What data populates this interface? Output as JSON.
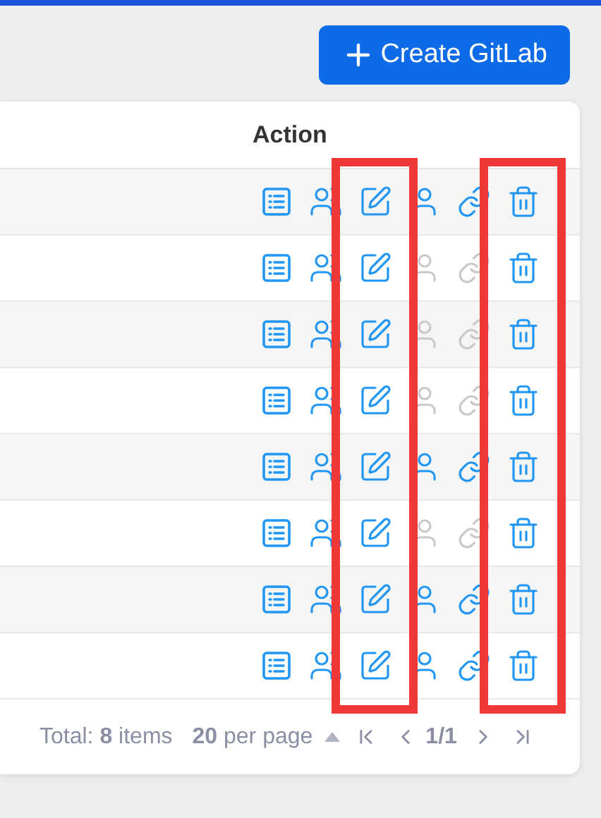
{
  "create_button": {
    "label": "Create GitLab"
  },
  "table": {
    "columns": [
      {
        "label": "Action"
      }
    ],
    "action_columns": [
      {
        "kind": "list",
        "highlighted": false
      },
      {
        "kind": "members",
        "highlighted": false
      },
      {
        "kind": "edit",
        "highlighted": true
      },
      {
        "kind": "user",
        "highlighted": false
      },
      {
        "kind": "link",
        "highlighted": false
      },
      {
        "kind": "delete",
        "highlighted": true
      }
    ],
    "rows": [
      {
        "user_enabled": true,
        "link_enabled": true
      },
      {
        "user_enabled": false,
        "link_enabled": false
      },
      {
        "user_enabled": false,
        "link_enabled": false
      },
      {
        "user_enabled": false,
        "link_enabled": false
      },
      {
        "user_enabled": true,
        "link_enabled": true
      },
      {
        "user_enabled": false,
        "link_enabled": false
      },
      {
        "user_enabled": true,
        "link_enabled": true
      },
      {
        "user_enabled": true,
        "link_enabled": true
      }
    ]
  },
  "pagination": {
    "total": "Total: **8** items",
    "page_size": "**20** per page",
    "page": "1/1"
  }
}
